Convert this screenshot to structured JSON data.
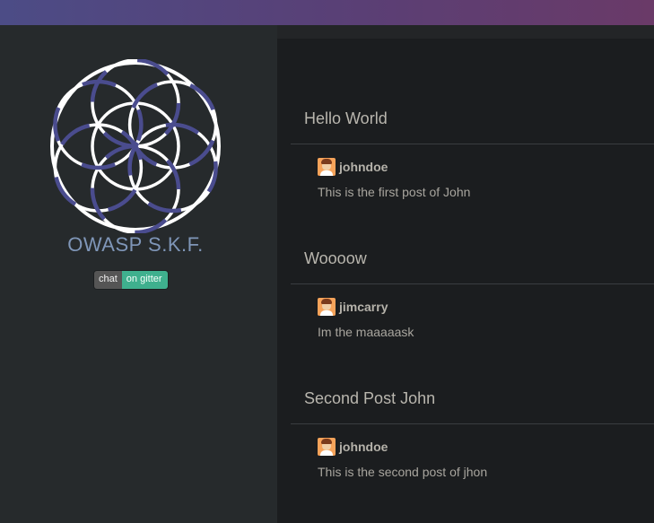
{
  "sidebar": {
    "brand": "OWASP S.K.F.",
    "gitter_left": "chat",
    "gitter_right": "on gitter"
  },
  "posts": [
    {
      "title": "Hello World",
      "author": "johndoe",
      "body": "This is the first post of John"
    },
    {
      "title": "Woooow",
      "author": "jimcarry",
      "body": "Im the maaaaask"
    },
    {
      "title": "Second Post John",
      "author": "johndoe",
      "body": "This is the second post of jhon"
    }
  ],
  "colors": {
    "topbar_left": "#4c4c86",
    "topbar_right": "#6a3a68",
    "logo_ring": "#ffffff",
    "logo_petal": "#4a4c8e",
    "brand_text": "#7f96b8",
    "gitter_green": "#3fb08e"
  }
}
